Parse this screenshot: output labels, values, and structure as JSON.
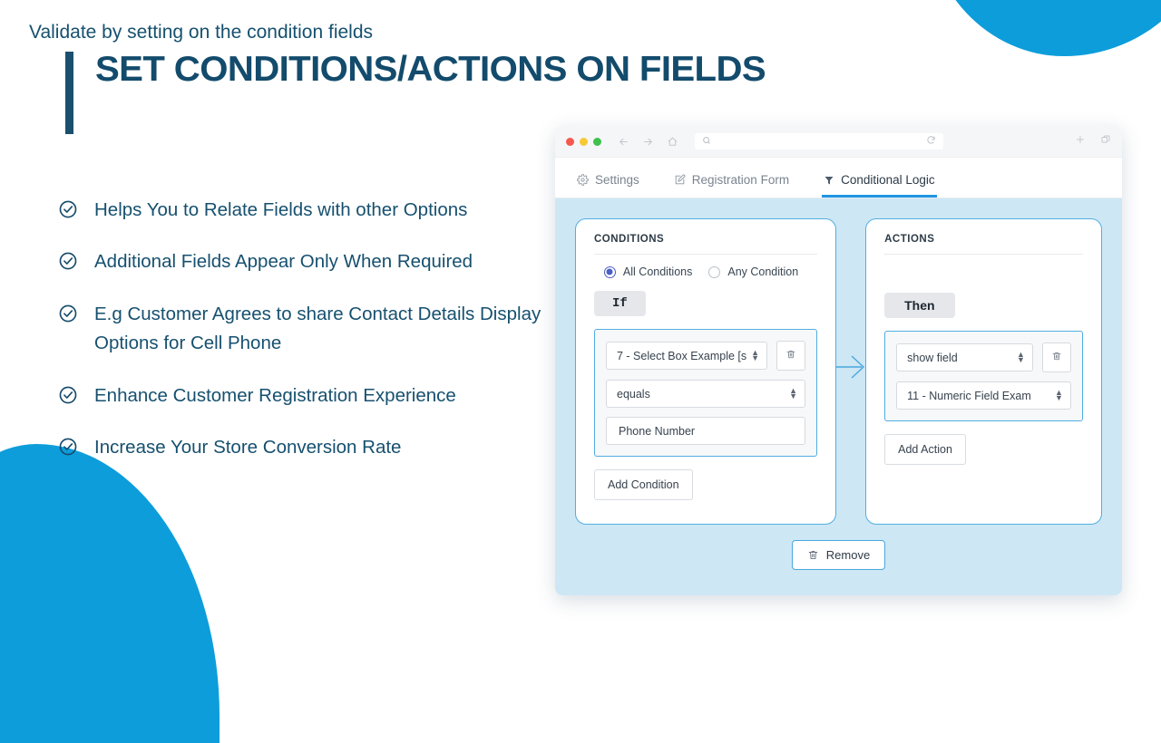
{
  "slide": {
    "title": "SET CONDITIONS/ACTIONS ON FIELDS",
    "subtitle": "Validate by setting on the condition fields",
    "accent_color": "#1b4f6e",
    "brand_blue": "#0d9ddb",
    "bullets": [
      {
        "icon": "check-circle-icon",
        "text": "Helps You to Relate Fields with other Options"
      },
      {
        "icon": "check-circle-icon",
        "text": "Additional Fields Appear Only When Required"
      },
      {
        "icon": "check-circle-icon",
        "text": "E.g Customer Agrees to share Contact Details Display Options for Cell Phone"
      },
      {
        "icon": "check-circle-icon",
        "text": "Enhance Customer Registration Experience"
      },
      {
        "icon": "check-circle-icon",
        "text": "Increase Your Store Conversion Rate"
      }
    ]
  },
  "browser": {
    "traffic_lights": [
      "red",
      "yellow",
      "green"
    ],
    "nav_icons": [
      "back-arrow-icon",
      "forward-arrow-icon",
      "home-icon"
    ],
    "url_value": "",
    "url_placeholder": "",
    "search_icon": "search-icon",
    "reload_icon": "reload-icon",
    "right_icons": [
      "plus-icon",
      "duplicate-window-icon"
    ]
  },
  "tabs": [
    {
      "label": "Settings",
      "icon": "gear-icon",
      "active": false
    },
    {
      "label": "Registration Form",
      "icon": "edit-square-icon",
      "active": false
    },
    {
      "label": "Conditional Logic",
      "icon": "filter-icon",
      "active": true
    }
  ],
  "conditions_panel": {
    "title": "CONDITIONS",
    "match_options": [
      {
        "label": "All Conditions",
        "selected": true
      },
      {
        "label": "Any Condition",
        "selected": false
      }
    ],
    "keyword_badge": "If",
    "rule": {
      "field_select": "7 - Select Box Example [s",
      "operator_select": "equals",
      "value_input": "Phone Number",
      "value_placeholder": "Phone Number",
      "delete_icon": "trash-icon"
    },
    "add_button": "Add Condition"
  },
  "actions_panel": {
    "title": "ACTIONS",
    "keyword_badge": "Then",
    "rule": {
      "action_select": "show field",
      "target_select": "11 - Numeric Field Exam",
      "delete_icon": "trash-icon"
    },
    "add_button": "Add Action"
  },
  "footer": {
    "remove_button": "Remove",
    "remove_icon": "trash-icon"
  },
  "colors": {
    "content_background": "#cde7f5",
    "panel_border": "#52aee0",
    "tab_active_underline": "#2196e3",
    "radio_selected": "#4b5fc4",
    "title_navy": "#134b6c"
  }
}
